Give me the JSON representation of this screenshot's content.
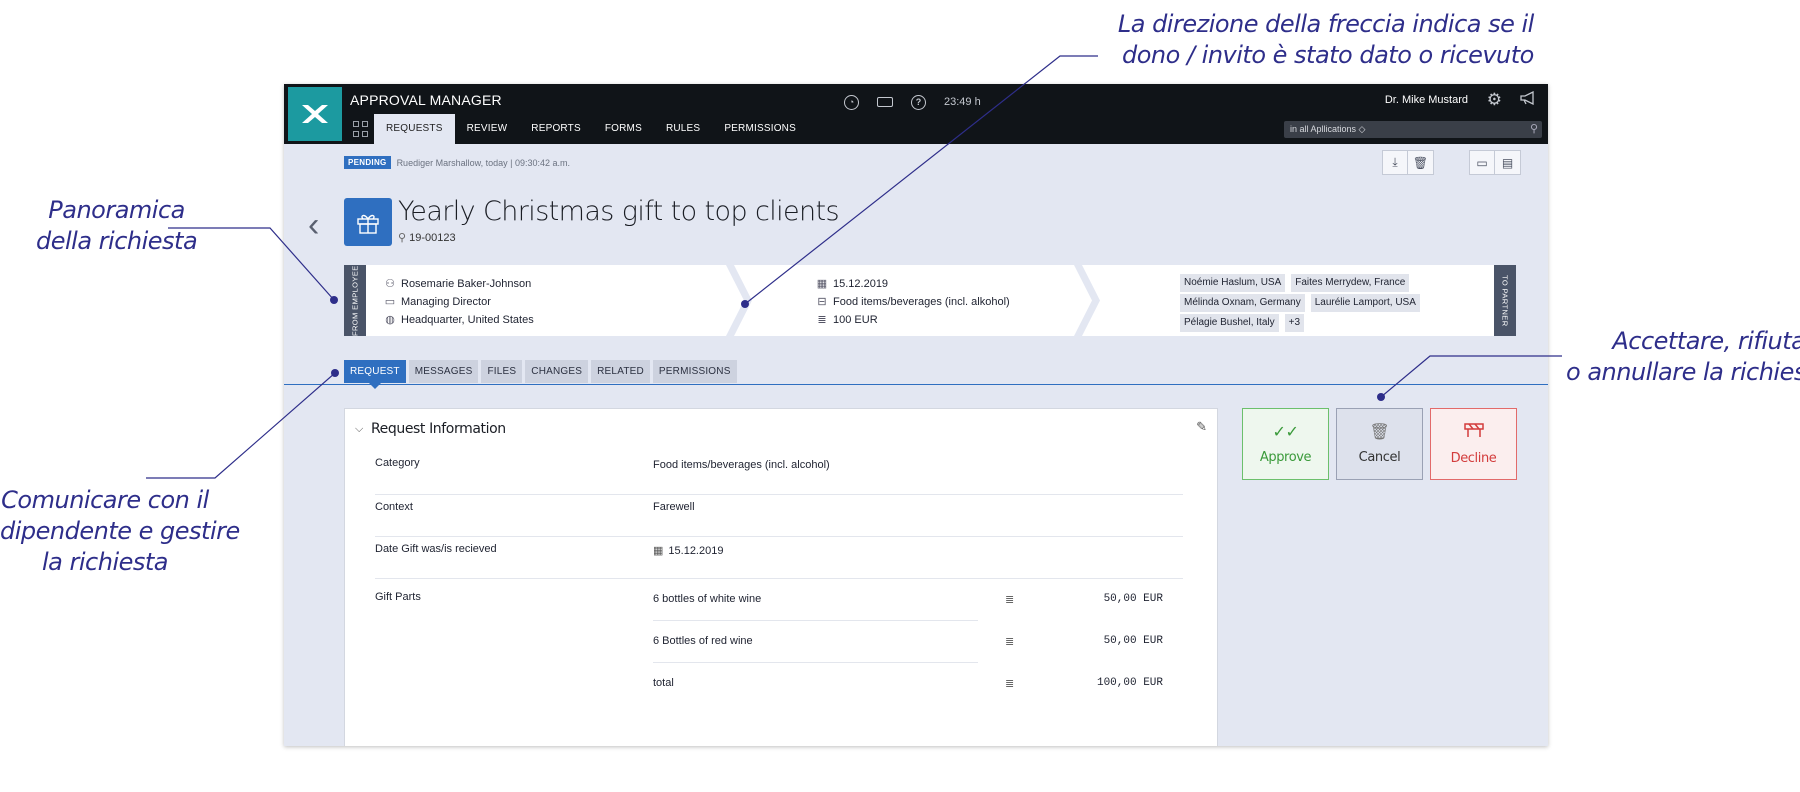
{
  "annotations": {
    "arrow_direction_line1": "La direzione della freccia indica se il",
    "arrow_direction_line2": "dono / invito è stato dato o ricevuto",
    "overview_line1": "Panoramica",
    "overview_line2": "della richiesta",
    "actions_line1": "Accettare, rifiutare",
    "actions_line2": "o annullare la richiesta",
    "communicate_line1": "Comunicare con il",
    "communicate_line2": "dipendente e gestire",
    "communicate_line3": "la richiesta"
  },
  "app": {
    "title": "APPROVAL MANAGER",
    "time": "23:49 h",
    "user": "Dr. Mike Mustard",
    "scope_select": "in all Apllications ◇",
    "nav": [
      "REQUESTS",
      "REVIEW",
      "REPORTS",
      "FORMS",
      "RULES",
      "PERMISSIONS"
    ],
    "active_nav": "REQUESTS"
  },
  "status": {
    "badge": "PENDING",
    "text": "Ruediger Marshallow, today | 09:30:42 a.m."
  },
  "request": {
    "title": "Yearly Christmas gift to top clients",
    "id": "19-00123"
  },
  "flow": {
    "from_tag": "FROM EMPLOYEE",
    "to_tag": "TO PARTNER",
    "employee": {
      "name": "Rosemarie Baker-Johnson",
      "role": "Managing Director",
      "location": "Headquarter, United States"
    },
    "gift": {
      "date": "15.12.2019",
      "category": "Food items/beverages (incl. alkohol)",
      "amount": "100 EUR"
    },
    "partners": [
      "Noémie Haslum, USA",
      "Faites Merrydew, France",
      "Mélinda Oxnam, Germany",
      "Laurélie Lamport, USA",
      "Pélagie Bushel, Italy",
      "+3"
    ]
  },
  "tabs": [
    "REQUEST",
    "MESSAGES",
    "FILES",
    "CHANGES",
    "RELATED",
    "PERMISSIONS"
  ],
  "panel": {
    "title": "Request Information",
    "rows": [
      {
        "label": "Category",
        "value": "Food items/beverages (incl. alcohol)"
      },
      {
        "label": "Context",
        "value": "Farewell"
      },
      {
        "label": "Date Gift was/is recieved",
        "value": "15.12.2019"
      }
    ],
    "gift_parts_label": "Gift Parts",
    "gift_parts": [
      {
        "name": "6 bottles of white wine",
        "amount": "50,00 EUR"
      },
      {
        "name": "6 Bottles of red wine",
        "amount": "50,00 EUR"
      },
      {
        "name": "total",
        "amount": "100,00 EUR"
      }
    ]
  },
  "actions": {
    "approve": "Approve",
    "cancel": "Cancel",
    "decline": "Decline"
  },
  "colors": {
    "accent": "#2f6fc0",
    "logo": "#1c9aa0",
    "annotation": "#2e2e8a",
    "approve": "#3a9a3a",
    "decline": "#d33c3c"
  }
}
